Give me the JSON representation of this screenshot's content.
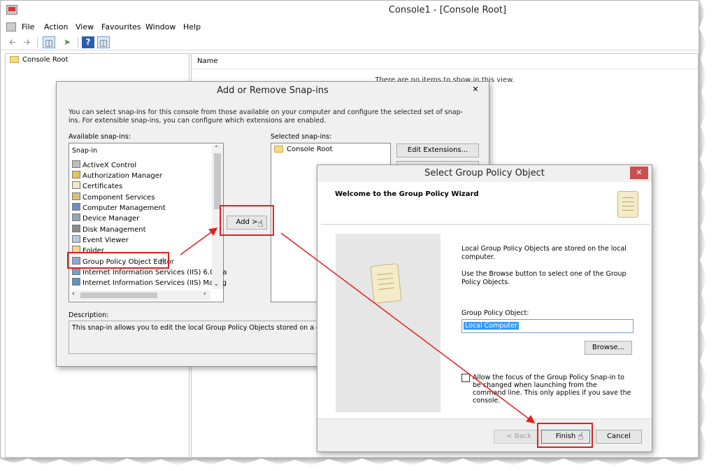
{
  "main_window": {
    "title": "Console1 - [Console Root]",
    "menu": [
      "File",
      "Action",
      "View",
      "Favourites",
      "Window",
      "Help"
    ],
    "tree_root": "Console Root",
    "list_header": "Name",
    "empty_message": "There are no items to show in this view."
  },
  "snapin_dialog": {
    "title": "Add or Remove Snap-ins",
    "intro": "You can select snap-ins for this console from those available on your computer and configure the selected set of snap-ins. For extensible snap-ins, you can configure which extensions are enabled.",
    "available_label": "Available snap-ins:",
    "column_header": "Snap-in",
    "snapins": [
      "ActiveX Control",
      "Authorization Manager",
      "Certificates",
      "Component Services",
      "Computer Management",
      "Device Manager",
      "Disk Management",
      "Event Viewer",
      "Folder",
      "Group Policy Object Editor",
      "Internet Information Services (IIS) 6.0 Ma",
      "Internet Information Services (IIS) Manag"
    ],
    "selected_label": "Selected snap-ins:",
    "selected_items": [
      "Console Root"
    ],
    "add_button": "Add >",
    "edit_extensions_button": "Edit Extensions...",
    "description_label": "Description:",
    "description_text": "This snap-in allows you to edit the local Group Policy Objects stored on a compute"
  },
  "gpo_dialog": {
    "title": "Select Group Policy Object",
    "heading": "Welcome to the Group Policy Wizard",
    "info_1": "Local Group Policy Objects are stored on the local computer.",
    "info_2": "Use the Browse button to select one of the Group Policy Objects.",
    "gpo_label": "Group Policy Object:",
    "gpo_value": "Local Computer",
    "browse_button": "Browse...",
    "checkbox_label": "Allow the focus of the Group Policy Snap-in to be changed when launching from the command line. This only applies if you save the console.",
    "back_button": "< Back",
    "finish_button": "Finish",
    "cancel_button": "Cancel"
  },
  "colors": {
    "annotation_red": "#e02020",
    "selection_blue": "#3399ff",
    "close_red": "#c75050"
  }
}
